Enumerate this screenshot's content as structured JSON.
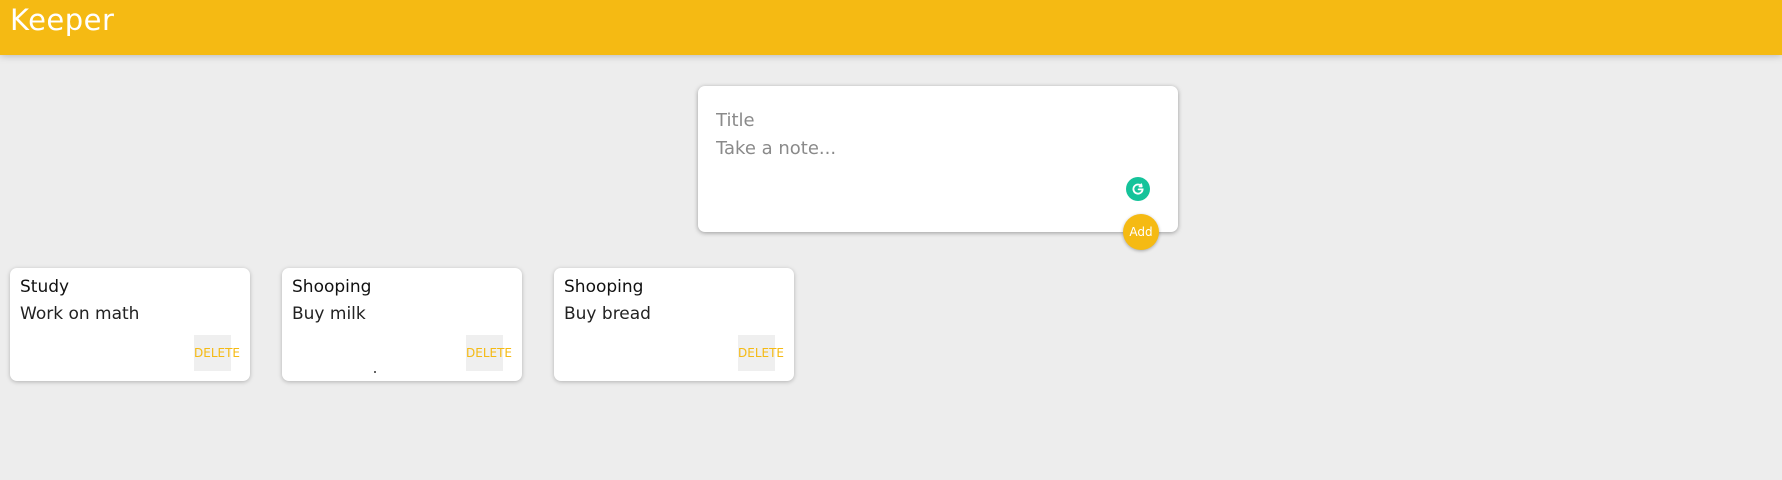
{
  "header": {
    "brand": "Keeper"
  },
  "composer": {
    "title_placeholder": "Title",
    "content_placeholder": "Take a note...",
    "add_label": "Add"
  },
  "notes": [
    {
      "title": "Study",
      "content": "Work on math",
      "delete_label": "DELETE"
    },
    {
      "title": "Shooping",
      "content": "Buy milk",
      "delete_label": "DELETE"
    },
    {
      "title": "Shooping",
      "content": "Buy bread",
      "delete_label": "DELETE"
    }
  ],
  "colors": {
    "accent": "#f5ba13",
    "background": "#ededed",
    "grammarly": "#15c39a"
  }
}
